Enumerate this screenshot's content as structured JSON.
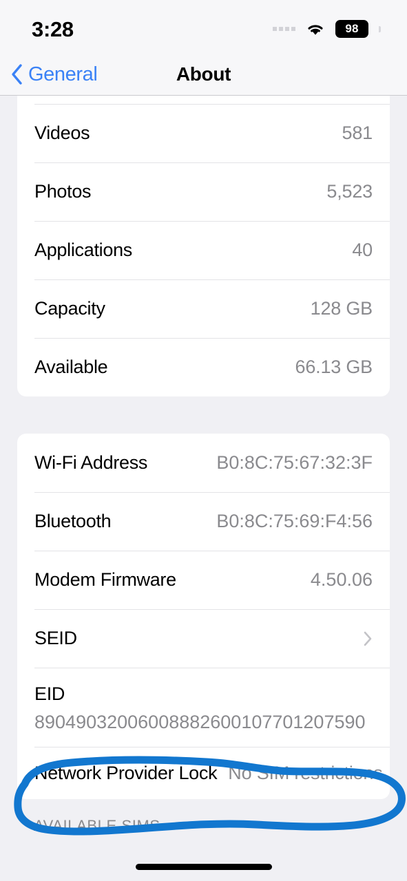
{
  "status_bar": {
    "time": "3:28",
    "battery_percent": "98",
    "signal_icon": "signal-dots-icon",
    "wifi_icon": "wifi-icon",
    "battery_icon": "battery-icon"
  },
  "nav": {
    "back_label": "General",
    "back_icon": "chevron-left-icon",
    "title": "About"
  },
  "groups": [
    {
      "id": "storage-group",
      "rows": [
        {
          "label": "Videos",
          "value": "581"
        },
        {
          "label": "Photos",
          "value": "5,523"
        },
        {
          "label": "Applications",
          "value": "40"
        },
        {
          "label": "Capacity",
          "value": "128 GB"
        },
        {
          "label": "Available",
          "value": "66.13 GB"
        }
      ]
    },
    {
      "id": "identifiers-group",
      "rows": [
        {
          "label": "Wi-Fi Address",
          "value": "B0:8C:75:67:32:3F"
        },
        {
          "label": "Bluetooth",
          "value": "B0:8C:75:69:F4:56"
        },
        {
          "label": "Modem Firmware",
          "value": "4.50.06"
        },
        {
          "label": "SEID",
          "value": "",
          "accessory": "chevron-right-icon"
        },
        {
          "label": "EID",
          "value": "89049032006008882600107701207590",
          "stacked": true
        },
        {
          "label": "Network Provider Lock",
          "value": "No SIM restrictions",
          "highlighted": true
        }
      ]
    }
  ],
  "section_header": "AVAILABLE SIMS",
  "annotation": {
    "shape": "hand-drawn-ellipse",
    "color": "#1277CF",
    "targets": "Network Provider Lock"
  },
  "colors": {
    "accent": "#3b82f6",
    "page_background": "#f0f0f4",
    "card_background": "#ffffff",
    "secondary_text": "#8a8a8e",
    "annotation": "#1277CF"
  }
}
